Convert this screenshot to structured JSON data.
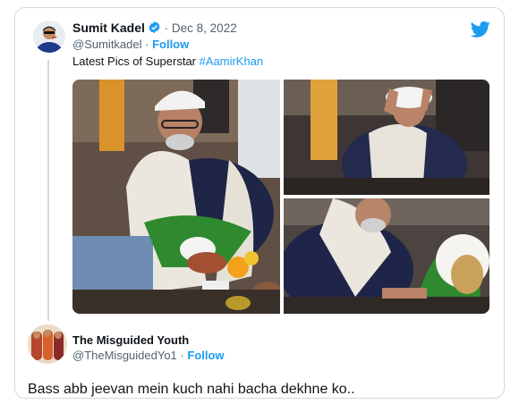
{
  "original_tweet": {
    "author_name": "Sumit Kadel",
    "date": "Dec 8, 2022",
    "handle": "@Sumitkadel",
    "separator": " · ",
    "follow_label": "Follow",
    "text_prefix": "Latest Pics of Superstar ",
    "hashtag": "#AamirKhan",
    "photos": [
      "photo-ritual-main",
      "photo-hands-on-head",
      "photo-coconut-offering"
    ],
    "icons": [
      "avatar",
      "verified-badge-icon",
      "twitter-bird-icon"
    ]
  },
  "reply": {
    "author_name": "The Misguided Youth",
    "handle": "@TheMisguidedYo1",
    "separator": " · ",
    "follow_label": "Follow",
    "text": "Bass abb jeevan mein kuch nahi bacha dekhne ko.."
  },
  "colors": {
    "accent": "#1d9bf0",
    "border": "#cfd9de",
    "secondary_text": "#536471"
  }
}
